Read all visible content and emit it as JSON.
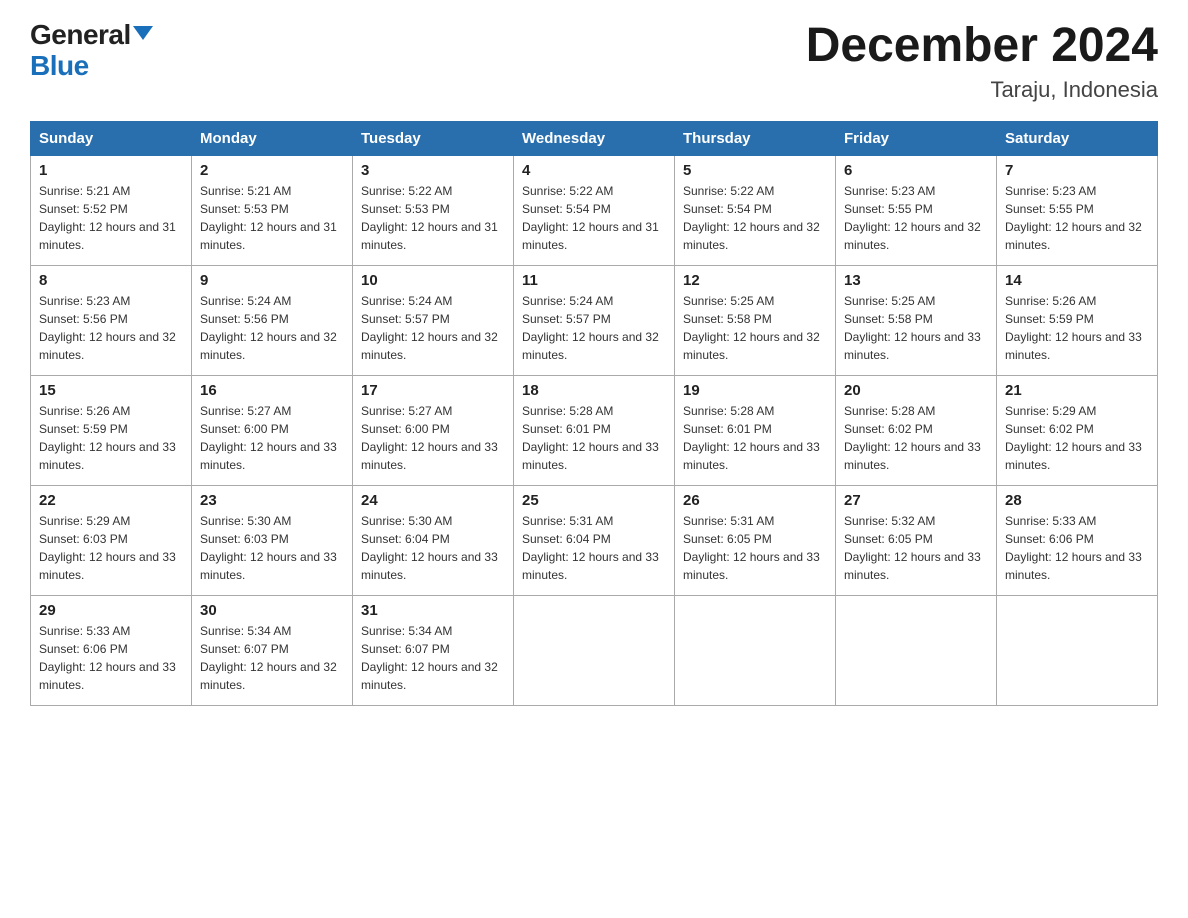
{
  "logo": {
    "general": "General",
    "blue": "Blue"
  },
  "title": {
    "month_year": "December 2024",
    "location": "Taraju, Indonesia"
  },
  "headers": [
    "Sunday",
    "Monday",
    "Tuesday",
    "Wednesday",
    "Thursday",
    "Friday",
    "Saturday"
  ],
  "weeks": [
    [
      {
        "day": "1",
        "sunrise": "5:21 AM",
        "sunset": "5:52 PM",
        "daylight": "12 hours and 31 minutes."
      },
      {
        "day": "2",
        "sunrise": "5:21 AM",
        "sunset": "5:53 PM",
        "daylight": "12 hours and 31 minutes."
      },
      {
        "day": "3",
        "sunrise": "5:22 AM",
        "sunset": "5:53 PM",
        "daylight": "12 hours and 31 minutes."
      },
      {
        "day": "4",
        "sunrise": "5:22 AM",
        "sunset": "5:54 PM",
        "daylight": "12 hours and 31 minutes."
      },
      {
        "day": "5",
        "sunrise": "5:22 AM",
        "sunset": "5:54 PM",
        "daylight": "12 hours and 32 minutes."
      },
      {
        "day": "6",
        "sunrise": "5:23 AM",
        "sunset": "5:55 PM",
        "daylight": "12 hours and 32 minutes."
      },
      {
        "day": "7",
        "sunrise": "5:23 AM",
        "sunset": "5:55 PM",
        "daylight": "12 hours and 32 minutes."
      }
    ],
    [
      {
        "day": "8",
        "sunrise": "5:23 AM",
        "sunset": "5:56 PM",
        "daylight": "12 hours and 32 minutes."
      },
      {
        "day": "9",
        "sunrise": "5:24 AM",
        "sunset": "5:56 PM",
        "daylight": "12 hours and 32 minutes."
      },
      {
        "day": "10",
        "sunrise": "5:24 AM",
        "sunset": "5:57 PM",
        "daylight": "12 hours and 32 minutes."
      },
      {
        "day": "11",
        "sunrise": "5:24 AM",
        "sunset": "5:57 PM",
        "daylight": "12 hours and 32 minutes."
      },
      {
        "day": "12",
        "sunrise": "5:25 AM",
        "sunset": "5:58 PM",
        "daylight": "12 hours and 32 minutes."
      },
      {
        "day": "13",
        "sunrise": "5:25 AM",
        "sunset": "5:58 PM",
        "daylight": "12 hours and 33 minutes."
      },
      {
        "day": "14",
        "sunrise": "5:26 AM",
        "sunset": "5:59 PM",
        "daylight": "12 hours and 33 minutes."
      }
    ],
    [
      {
        "day": "15",
        "sunrise": "5:26 AM",
        "sunset": "5:59 PM",
        "daylight": "12 hours and 33 minutes."
      },
      {
        "day": "16",
        "sunrise": "5:27 AM",
        "sunset": "6:00 PM",
        "daylight": "12 hours and 33 minutes."
      },
      {
        "day": "17",
        "sunrise": "5:27 AM",
        "sunset": "6:00 PM",
        "daylight": "12 hours and 33 minutes."
      },
      {
        "day": "18",
        "sunrise": "5:28 AM",
        "sunset": "6:01 PM",
        "daylight": "12 hours and 33 minutes."
      },
      {
        "day": "19",
        "sunrise": "5:28 AM",
        "sunset": "6:01 PM",
        "daylight": "12 hours and 33 minutes."
      },
      {
        "day": "20",
        "sunrise": "5:28 AM",
        "sunset": "6:02 PM",
        "daylight": "12 hours and 33 minutes."
      },
      {
        "day": "21",
        "sunrise": "5:29 AM",
        "sunset": "6:02 PM",
        "daylight": "12 hours and 33 minutes."
      }
    ],
    [
      {
        "day": "22",
        "sunrise": "5:29 AM",
        "sunset": "6:03 PM",
        "daylight": "12 hours and 33 minutes."
      },
      {
        "day": "23",
        "sunrise": "5:30 AM",
        "sunset": "6:03 PM",
        "daylight": "12 hours and 33 minutes."
      },
      {
        "day": "24",
        "sunrise": "5:30 AM",
        "sunset": "6:04 PM",
        "daylight": "12 hours and 33 minutes."
      },
      {
        "day": "25",
        "sunrise": "5:31 AM",
        "sunset": "6:04 PM",
        "daylight": "12 hours and 33 minutes."
      },
      {
        "day": "26",
        "sunrise": "5:31 AM",
        "sunset": "6:05 PM",
        "daylight": "12 hours and 33 minutes."
      },
      {
        "day": "27",
        "sunrise": "5:32 AM",
        "sunset": "6:05 PM",
        "daylight": "12 hours and 33 minutes."
      },
      {
        "day": "28",
        "sunrise": "5:33 AM",
        "sunset": "6:06 PM",
        "daylight": "12 hours and 33 minutes."
      }
    ],
    [
      {
        "day": "29",
        "sunrise": "5:33 AM",
        "sunset": "6:06 PM",
        "daylight": "12 hours and 33 minutes."
      },
      {
        "day": "30",
        "sunrise": "5:34 AM",
        "sunset": "6:07 PM",
        "daylight": "12 hours and 32 minutes."
      },
      {
        "day": "31",
        "sunrise": "5:34 AM",
        "sunset": "6:07 PM",
        "daylight": "12 hours and 32 minutes."
      },
      null,
      null,
      null,
      null
    ]
  ]
}
